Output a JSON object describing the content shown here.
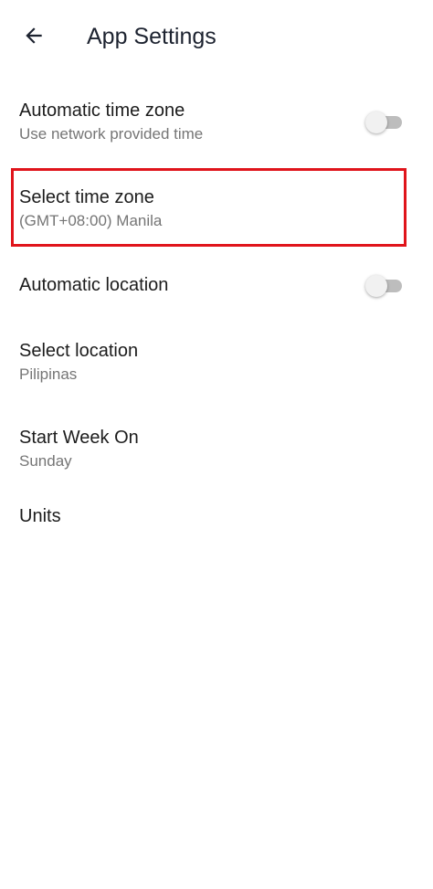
{
  "header": {
    "title": "App Settings",
    "back_icon": "arrow-left-icon"
  },
  "settings": {
    "automatic_time_zone": {
      "title": "Automatic time zone",
      "subtitle": "Use network provided time",
      "toggle_on": false
    },
    "select_time_zone": {
      "title": "Select time zone",
      "subtitle": "(GMT+08:00) Manila"
    },
    "automatic_location": {
      "title": "Automatic location",
      "toggle_on": false
    },
    "select_location": {
      "title": "Select location",
      "subtitle": "Pilipinas"
    },
    "start_week_on": {
      "title": "Start Week On",
      "subtitle": "Sunday"
    },
    "units": {
      "title": "Units"
    }
  },
  "colors": {
    "highlight": "#e0141b",
    "toggle_track_off": "#bdbdbd",
    "toggle_thumb_off": "#f1f1f1"
  }
}
